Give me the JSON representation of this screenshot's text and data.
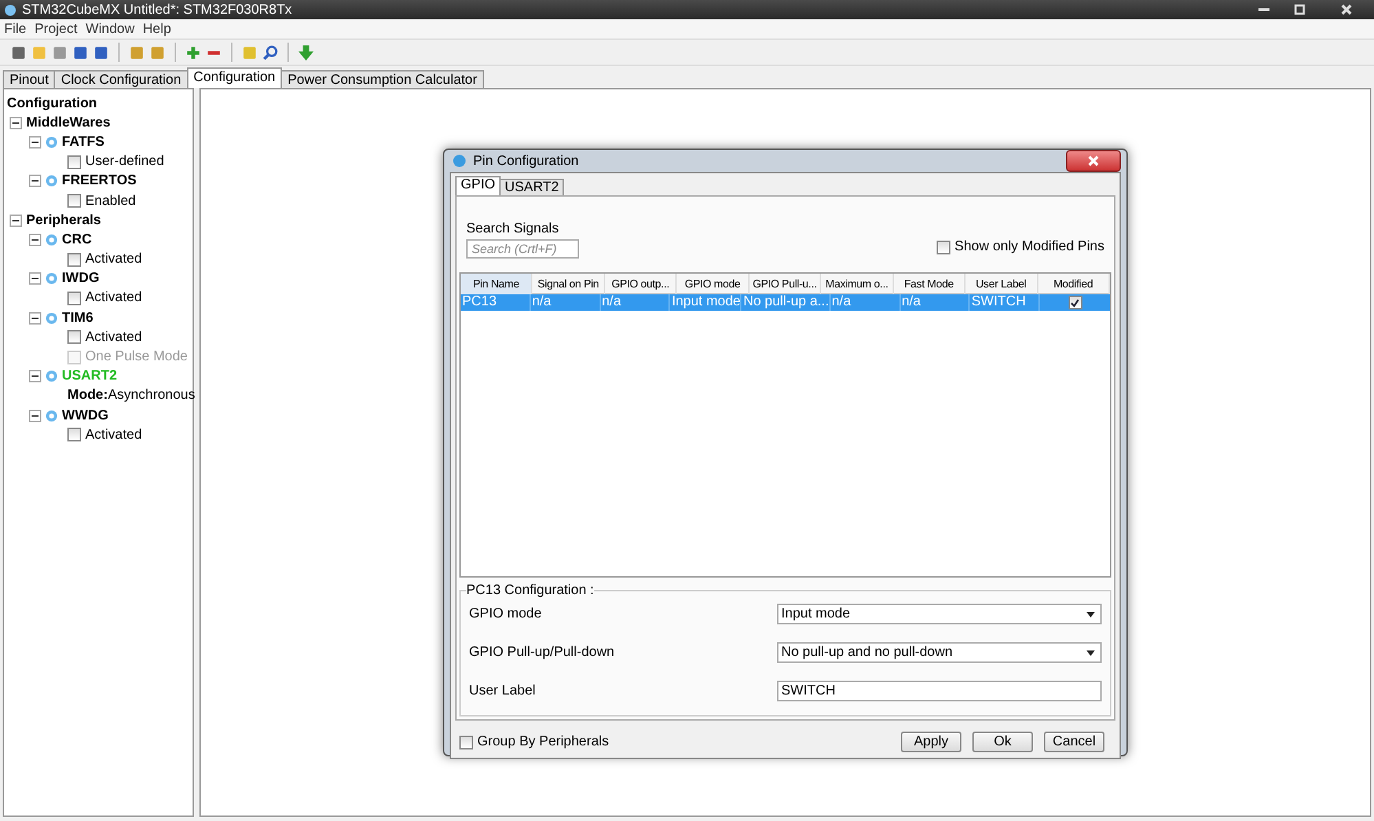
{
  "window": {
    "title": "STM32CubeMX Untitled*: STM32F030R8Tx"
  },
  "menu": [
    "File",
    "Project",
    "Window",
    "Help"
  ],
  "tabs": [
    {
      "label": "Pinout",
      "selected": false
    },
    {
      "label": "Clock Configuration",
      "selected": false
    },
    {
      "label": "Configuration",
      "selected": true
    },
    {
      "label": "Power Consumption Calculator",
      "selected": false
    }
  ],
  "tree": {
    "label": "Configuration",
    "children": [
      {
        "label": "MiddleWares",
        "children": [
          {
            "label": "FATFS",
            "active": false,
            "children": [
              {
                "kind": "checkbox",
                "label": "User-defined",
                "checked": false,
                "disabled": false
              }
            ]
          },
          {
            "label": "FREERTOS",
            "active": false,
            "children": [
              {
                "kind": "checkbox",
                "label": "Enabled",
                "checked": false,
                "disabled": false
              }
            ]
          }
        ]
      },
      {
        "label": "Peripherals",
        "children": [
          {
            "label": "CRC",
            "active": false,
            "children": [
              {
                "kind": "checkbox",
                "label": "Activated",
                "checked": false,
                "disabled": false
              }
            ]
          },
          {
            "label": "IWDG",
            "active": false,
            "children": [
              {
                "kind": "checkbox",
                "label": "Activated",
                "checked": false,
                "disabled": false
              }
            ]
          },
          {
            "label": "TIM6",
            "active": false,
            "children": [
              {
                "kind": "checkbox",
                "label": "Activated",
                "checked": false,
                "disabled": false
              },
              {
                "kind": "checkbox",
                "label": "One Pulse Mode",
                "checked": false,
                "disabled": true
              }
            ]
          },
          {
            "label": "USART2",
            "active": true,
            "children": [
              {
                "kind": "mode",
                "label": "Mode:",
                "value": "Asynchronous"
              }
            ]
          },
          {
            "label": "WWDG",
            "active": false,
            "children": [
              {
                "kind": "checkbox",
                "label": "Activated",
                "checked": false,
                "disabled": false
              }
            ]
          }
        ]
      }
    ]
  },
  "dialog": {
    "title": "Pin Configuration",
    "tabs": [
      {
        "label": "GPIO",
        "selected": true
      },
      {
        "label": "USART2",
        "selected": false
      }
    ],
    "search": {
      "label": "Search Signals",
      "placeholder": "Search (Crtl+F)"
    },
    "show_modified": {
      "label": "Show only Modified Pins",
      "checked": false
    },
    "table": {
      "columns": [
        "Pin Name",
        "Signal on Pin",
        "GPIO outp...",
        "GPIO mode",
        "GPIO Pull-u...",
        "Maximum o...",
        "Fast Mode",
        "User Label",
        "Modified"
      ],
      "rows": [
        {
          "cells": [
            "PC13",
            "n/a",
            "n/a",
            "Input mode",
            "No pull-up a...",
            "n/a",
            "n/a",
            "SWITCH"
          ],
          "modified": true,
          "selected": true
        }
      ]
    },
    "config": {
      "title": "PC13 Configuration :",
      "fields": [
        {
          "kind": "select",
          "label": "GPIO mode",
          "value": "Input mode"
        },
        {
          "kind": "select",
          "label": "GPIO Pull-up/Pull-down",
          "value": "No pull-up and no pull-down"
        },
        {
          "kind": "text",
          "label": "User Label",
          "value": "SWITCH"
        }
      ]
    },
    "group_by": {
      "label": "Group By Peripherals",
      "checked": false
    },
    "buttons": [
      "Apply",
      "Ok",
      "Cancel"
    ]
  }
}
